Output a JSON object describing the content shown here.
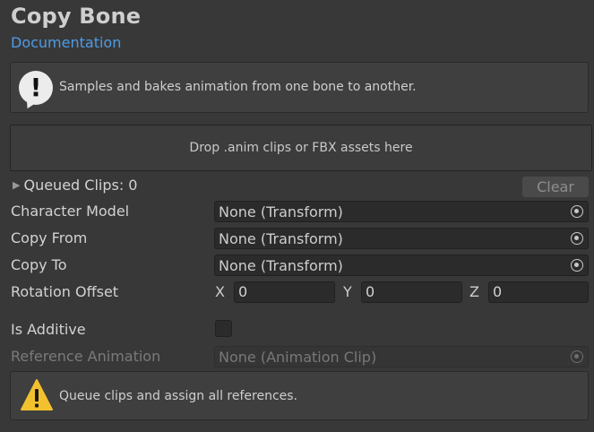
{
  "header": {
    "title": "Copy Bone",
    "doc_link": "Documentation"
  },
  "info": {
    "icon": "info-speech-bubble-icon",
    "text": "Samples and bakes animation from one bone to another."
  },
  "dropzone": {
    "text": "Drop .anim clips or FBX assets here"
  },
  "queue": {
    "label": "Queued Clips: 0",
    "clear_label": "Clear"
  },
  "fields": {
    "character_model": {
      "label": "Character Model",
      "value": "None (Transform)"
    },
    "copy_from": {
      "label": "Copy From",
      "value": "None (Transform)"
    },
    "copy_to": {
      "label": "Copy To",
      "value": "None (Transform)"
    },
    "rotation_offset": {
      "label": "Rotation Offset",
      "x_label": "X",
      "x": "0",
      "y_label": "Y",
      "y": "0",
      "z_label": "Z",
      "z": "0"
    },
    "is_additive": {
      "label": "Is Additive",
      "checked": false
    },
    "reference_animation": {
      "label": "Reference Animation",
      "value": "None (Animation Clip)"
    }
  },
  "warning": {
    "icon": "warning-icon",
    "text": "Queue clips and assign all references."
  },
  "colors": {
    "background": "#383838",
    "link": "#4d9be6",
    "warning": "#f2c12e"
  }
}
